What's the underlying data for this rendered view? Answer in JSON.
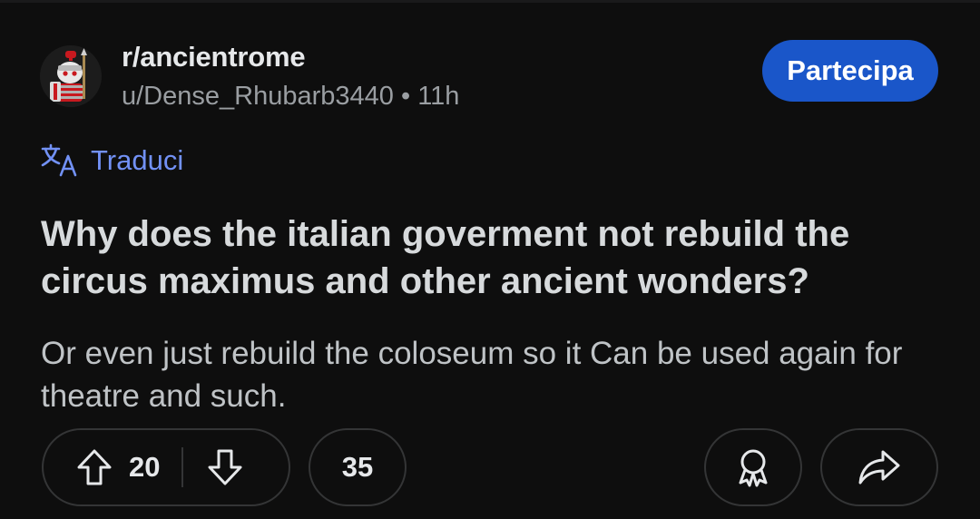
{
  "post": {
    "subreddit": "r/ancientrome",
    "author": "u/Dense_Rhubarb3440",
    "separator": "•",
    "age": "11h",
    "join_label": "Partecipa",
    "translate_label": "Traduci",
    "title": "Why does the italian goverment not rebuild the circus maximus and other ancient wonders?",
    "body": "Or even just rebuild the coloseum so it Can be used again for theatre and such."
  },
  "actions": {
    "upvote_icon": "arrow-up-icon",
    "downvote_icon": "arrow-down-icon",
    "score": "20",
    "comments": "35",
    "award_icon": "award-icon",
    "share_icon": "share-icon"
  },
  "colors": {
    "background": "#0e0e0e",
    "join_button": "#1a56c9",
    "translate_link": "#7291f5",
    "pill_border": "#343536"
  }
}
